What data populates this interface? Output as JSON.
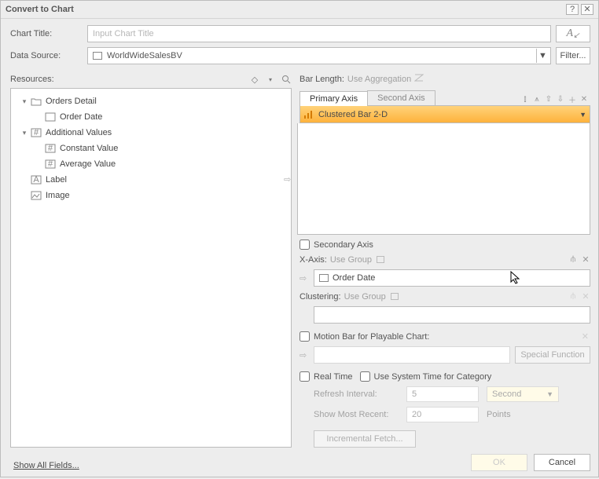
{
  "dialog": {
    "title": "Convert to Chart",
    "help_icon": "?",
    "close_icon": "✕"
  },
  "chartTitle": {
    "label": "Chart Title:",
    "placeholder": "Input Chart Title",
    "value": ""
  },
  "dataSource": {
    "label": "Data Source:",
    "value": "WorldWideSalesBV",
    "filter_btn": "Filter..."
  },
  "resources": {
    "label": "Resources:",
    "tree": {
      "ordersDetail": "Orders Detail",
      "orderDate": "Order Date",
      "additionalValues": "Additional Values",
      "constantValue": "Constant Value",
      "averageValue": "Average Value",
      "label": "Label",
      "image": "Image"
    },
    "showAll": "Show All Fields..."
  },
  "barLength": {
    "label": "Bar Length:",
    "hint": "Use Aggregation"
  },
  "tabs": {
    "primary": "Primary Axis",
    "secondary": "Second Axis"
  },
  "chartType": "Clustered Bar 2-D",
  "secondaryAxis": {
    "label": "Secondary Axis"
  },
  "xaxis": {
    "label": "X-Axis:",
    "hint": "Use Group",
    "value": "Order Date"
  },
  "clustering": {
    "label": "Clustering:",
    "hint": "Use Group"
  },
  "motionBar": {
    "label": "Motion Bar for Playable Chart:"
  },
  "specialFunction": "Special Function",
  "realTime": {
    "label": "Real Time",
    "useSystemTime": "Use System Time for Category"
  },
  "refreshInterval": {
    "label": "Refresh Interval:",
    "value": "5",
    "unit": "Second"
  },
  "showMostRecent": {
    "label": "Show Most Recent:",
    "value": "20",
    "unit": "Points"
  },
  "incrementalFetch": "Incremental Fetch...",
  "buttons": {
    "ok": "OK",
    "cancel": "Cancel"
  }
}
